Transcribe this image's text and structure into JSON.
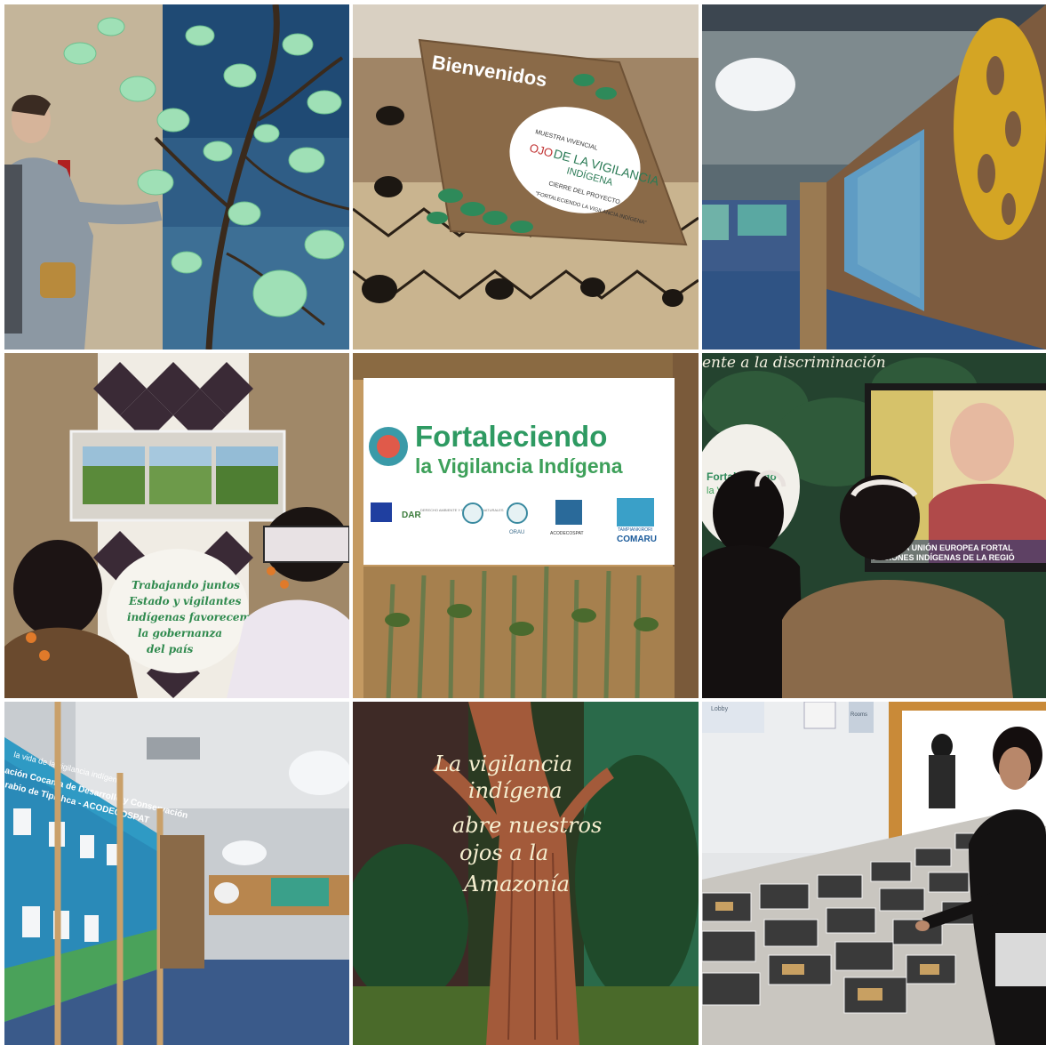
{
  "panels": {
    "welcome": {
      "heading": "Bienvenidos",
      "logo_top": "MUESTRA VIVENCIAL",
      "logo_main_1": "OJO",
      "logo_main_2": "DE LA VIGILANCIA",
      "logo_main_3": "INDÍGENA",
      "logo_sub_1": "CIERRE DEL PROYECTO",
      "logo_sub_2": "\"FORTALECIENDO LA VIGILANCIA INDÍGENA\""
    },
    "corridor": {
      "board_text": "ES DE LA UNIÓN EUROPEA FORTA",
      "board_text_2": "ZACIONES INDÍGENAS DE LA REGIÓ"
    },
    "governance": {
      "line1": "Trabajando juntos",
      "line2": "Estado y vigilantes",
      "line3": "indígenas favorecemos",
      "line4": "la gobernanza",
      "line5": "del país"
    },
    "banner": {
      "title_1": "Fortaleciendo",
      "title_2": "la Vigilancia Indígena",
      "logo_dar": "DAR",
      "logo_dar_text": "DERECHO AMBIENTE Y RECURSOS NATURALES",
      "logo_orau": "ORAU",
      "logo_acodecospat": "ACODECOSPAT",
      "logo_comaru_top": "TAMPIANKIRORI",
      "logo_comaru": "COMARU"
    },
    "video": {
      "wall_text": "ente a la discriminación",
      "sign_text_1": "Fortaleciendo",
      "sign_text_2": "la Vig",
      "screen_text_1": "ES DE LA UNIÓN EUROPEA FORTAL",
      "screen_text_2": "ZACIONES INDÍGENAS DE LA REGIÓ"
    },
    "exhibit": {
      "panel_line1": "la vida de la vigilancia indígena",
      "panel_line2": "ación Cocama de Desarrollo y Conservación",
      "panel_line3": "rabio de Tipishca - ACODECOSPAT"
    },
    "tree": {
      "line1": "La vigilancia",
      "line2": "indígena",
      "line3": "abre nuestros",
      "line4": "ojos a la",
      "line5": "Amazonía"
    },
    "books": {
      "sign1": "Lobby",
      "sign2": "Rooms"
    }
  }
}
